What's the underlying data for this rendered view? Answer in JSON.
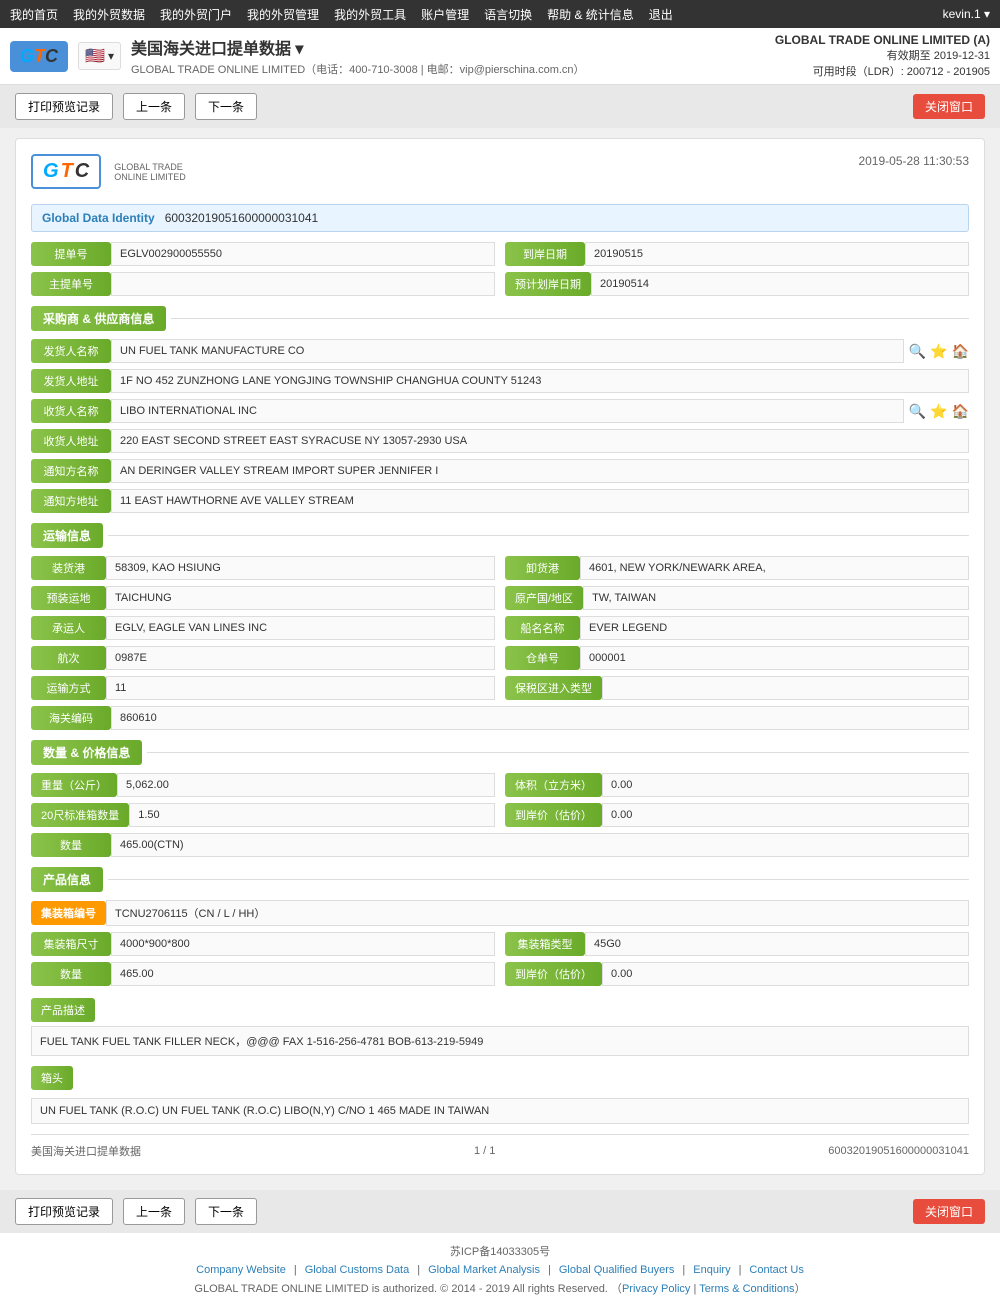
{
  "topnav": {
    "items": [
      {
        "label": "我的首页",
        "id": "home"
      },
      {
        "label": "我的外贸数据",
        "id": "data"
      },
      {
        "label": "我的外贸门户",
        "id": "portal"
      },
      {
        "label": "我的外贸管理",
        "id": "management"
      },
      {
        "label": "我的外贸工具",
        "id": "tools"
      },
      {
        "label": "账户管理",
        "id": "account"
      },
      {
        "label": "语言切换",
        "id": "language"
      },
      {
        "label": "帮助 & 统计信息",
        "id": "help"
      },
      {
        "label": "退出",
        "id": "logout"
      }
    ],
    "user": "kevin.1 ▾"
  },
  "header": {
    "logo": "GTC",
    "flag": "🇺🇸",
    "page_title": "美国海关进口提单数据 ▾",
    "subtitle": "GLOBAL TRADE ONLINE LIMITED（电话：400-710-3008 | 电邮：vip@pierschina.com.cn）",
    "company_name": "GLOBAL TRADE ONLINE LIMITED (A)",
    "valid_until": "有效期至 2019-12-31",
    "ldr": "可用时段（LDR）: 200712 - 201905"
  },
  "toolbar": {
    "print_label": "打印预览记录",
    "prev_label": "上一条",
    "next_label": "下一条",
    "close_label": "关闭窗口"
  },
  "document": {
    "logo": "GTC",
    "datetime": "2019-05-28 11:30:53",
    "global_data_identity_label": "Global Data Identity",
    "global_data_identity_value": "60032019051600000031041",
    "bill_no_label": "提单号",
    "bill_no_value": "EGLV002900055550",
    "arrival_date_label": "到岸日期",
    "arrival_date_value": "20190515",
    "master_bill_label": "主提单号",
    "master_bill_value": "",
    "planned_arrival_label": "预计划岸日期",
    "planned_arrival_value": "20190514"
  },
  "supplier_section": {
    "title": "采购商 & 供应商信息",
    "shipper_name_label": "发货人名称",
    "shipper_name_value": "UN FUEL TANK MANUFACTURE CO",
    "shipper_addr_label": "发货人地址",
    "shipper_addr_value": "1F NO 452 ZUNZHONG LANE YONGJING TOWNSHIP CHANGHUA COUNTY 51243",
    "consignee_name_label": "收货人名称",
    "consignee_name_value": "LIBO INTERNATIONAL INC",
    "consignee_addr_label": "收货人地址",
    "consignee_addr_value": "220 EAST SECOND STREET EAST SYRACUSE NY 13057-2930 USA",
    "notify_name_label": "通知方名称",
    "notify_name_value": "AN DERINGER VALLEY STREAM IMPORT SUPER JENNIFER I",
    "notify_addr_label": "通知方地址",
    "notify_addr_value": "11 EAST HAWTHORNE AVE VALLEY STREAM"
  },
  "transport_section": {
    "title": "运输信息",
    "loading_port_label": "装货港",
    "loading_port_value": "58309, KAO HSIUNG",
    "unloading_port_label": "卸货港",
    "unloading_port_value": "4601, NEW YORK/NEWARK AREA,",
    "pre_destination_label": "预装运地",
    "pre_destination_value": "TAICHUNG",
    "origin_label": "原产国/地区",
    "origin_value": "TW, TAIWAN",
    "carrier_label": "承运人",
    "carrier_value": "EGLV, EAGLE VAN LINES INC",
    "vessel_label": "船名名称",
    "vessel_value": "EVER LEGEND",
    "voyage_label": "航次",
    "voyage_value": "0987E",
    "container_no_label": "仓单号",
    "container_no_value": "000001",
    "transport_mode_label": "运输方式",
    "transport_mode_value": "11",
    "bonded_label": "保税区进入类型",
    "bonded_value": "",
    "customs_code_label": "海关编码",
    "customs_code_value": "860610"
  },
  "quantity_section": {
    "title": "数量 & 价格信息",
    "weight_label": "重量（公斤）",
    "weight_value": "5,062.00",
    "volume_label": "体积（立方米）",
    "volume_value": "0.00",
    "container_20_label": "20尺标准箱数量",
    "container_20_value": "1.50",
    "arrival_price_label": "到岸价（估价）",
    "arrival_price_value": "0.00",
    "qty_label": "数量",
    "qty_value": "465.00(CTN)"
  },
  "product_section": {
    "title": "产品信息",
    "container_no_label": "集装箱编号",
    "container_no_value": "TCNU2706115（CN / L / HH）",
    "container_size_label": "集装箱尺寸",
    "container_size_value": "4000*900*800",
    "container_type_label": "集装箱类型",
    "container_type_value": "45G0",
    "qty_label": "数量",
    "qty_value": "465.00",
    "arrival_price_label": "到岸价（估价）",
    "arrival_price_value": "0.00",
    "desc_label": "产品描述",
    "desc_value": "FUEL TANK FUEL TANK FILLER NECK，@@@ FAX 1-516-256-4781 BOB-613-219-5949",
    "marks_label": "箱头",
    "marks_value": "UN FUEL TANK (R.O.C) UN FUEL TANK (R.O.C) LIBO(N,Y) C/NO 1 465 MADE IN TAIWAN"
  },
  "doc_footer": {
    "title": "美国海关进口提单数据",
    "page": "1 / 1",
    "record_id": "60032019051600000031041"
  },
  "footer": {
    "icp": "苏ICP备14033305号",
    "links": [
      "Company Website",
      "Global Customs Data",
      "Global Market Analysis",
      "Global Qualified Buyers",
      "Enquiry",
      "Contact Us"
    ],
    "copyright": "GLOBAL TRADE ONLINE LIMITED is authorized. © 2014 - 2019 All rights Reserved.",
    "privacy": "Privacy Policy",
    "terms": "Terms & Conditions"
  }
}
